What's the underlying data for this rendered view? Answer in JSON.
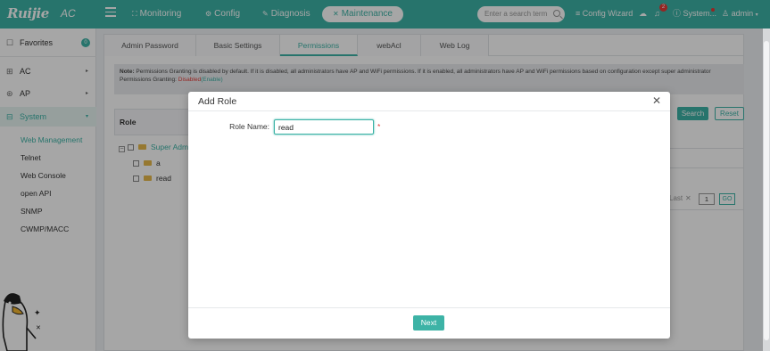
{
  "app": {
    "logo": "Ruijie",
    "logo_suffix": "AC",
    "accent_color": "#3db3a6"
  },
  "topnav": {
    "items": [
      {
        "label": "Monitoring",
        "icon": "monitor-icon"
      },
      {
        "label": "Config",
        "icon": "gear-icon"
      },
      {
        "label": "Diagnosis",
        "icon": "diagnosis-icon"
      },
      {
        "label": "Maintenance",
        "icon": "tools-icon",
        "active": true
      }
    ],
    "search_placeholder": "Enter a search term",
    "config_wizard": "Config Wizard",
    "notification_count": "2",
    "system_label": "System...",
    "user_label": "admin"
  },
  "sidebar": {
    "favorites": "Favorites",
    "favorites_count": "0",
    "items": [
      {
        "label": "AC"
      },
      {
        "label": "AP"
      },
      {
        "label": "System"
      }
    ],
    "system_children": [
      "Web Management",
      "Telnet",
      "Web Console",
      "open API",
      "SNMP",
      "CWMP/MACC"
    ]
  },
  "tabs": [
    "Admin Password",
    "Basic Settings",
    "Permissions",
    "webAcl",
    "Web Log"
  ],
  "permissions": {
    "note_label": "Note:",
    "note_text": "Permissions Granting is disabled by default. If it is disabled, all administrators have AP and WiFi permissions. If it is enabled, all administrators have AP and WiFi permissions based on configuration except super administrator",
    "granting_label": "Permissions Granting:",
    "granting_status": "Disabled",
    "granting_action": "(Enable)",
    "role_header": "Role",
    "roles": [
      "Super Admin",
      "a",
      "read"
    ],
    "search_button": "Search",
    "reset_button": "Reset",
    "pager_last": "Last",
    "page_number": "1",
    "go_button": "GO"
  },
  "modal": {
    "title": "Add Role",
    "role_name_label": "Role Name:",
    "role_name_value": "read",
    "required_mark": "*",
    "next_button": "Next"
  }
}
